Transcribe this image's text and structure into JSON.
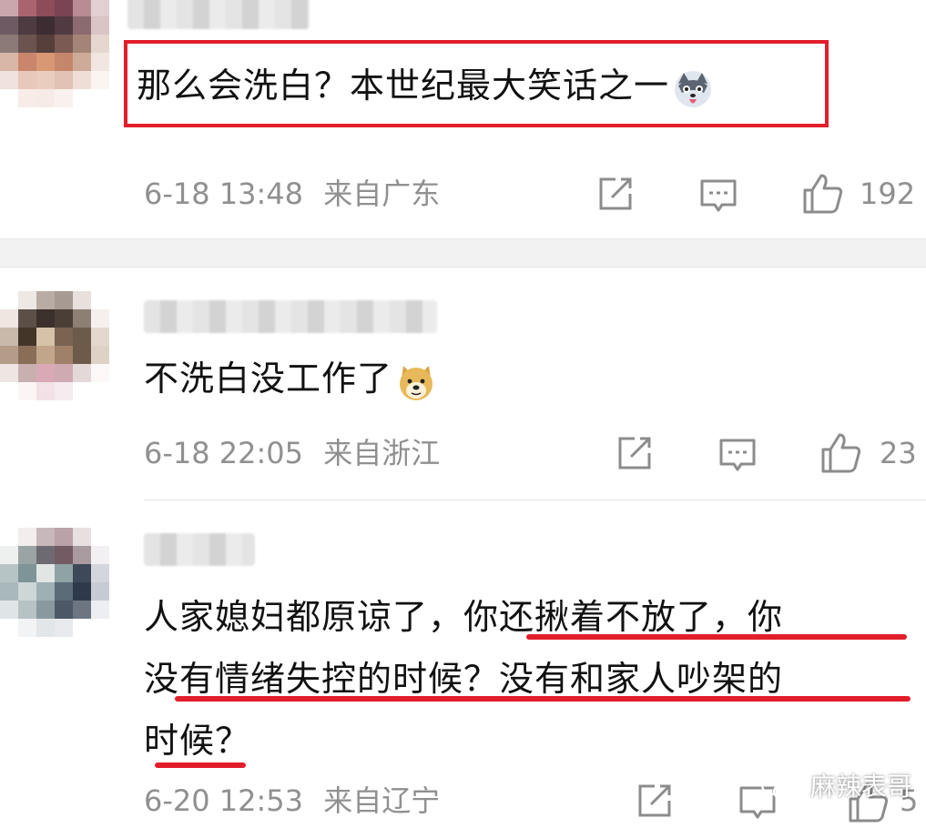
{
  "colors": {
    "highlight_red": "#e21e2b",
    "text_primary": "#111111",
    "meta_gray": "#909090",
    "divider": "#f2f2f2"
  },
  "comments": [
    {
      "text": "那么会洗白？本世纪最大笑话之一",
      "emoji": "husky-emoji",
      "date": "6-18 13:48",
      "location": "来自广东",
      "likes": "192"
    },
    {
      "text": "不洗白没工作了",
      "emoji": "doge-emoji",
      "date": "6-18 22:05",
      "location": "来自浙江",
      "likes": "23"
    },
    {
      "lines": [
        "人家媳妇都原谅了，你还揪着不放了，你",
        "没有情绪失控的时候？没有和家人吵架的",
        "时候？"
      ],
      "date": "6-20 12:53",
      "location": "来自辽宁",
      "likes": "5"
    }
  ],
  "watermark": {
    "text": "麻辣表哥",
    "icon": "wechat-icon"
  }
}
